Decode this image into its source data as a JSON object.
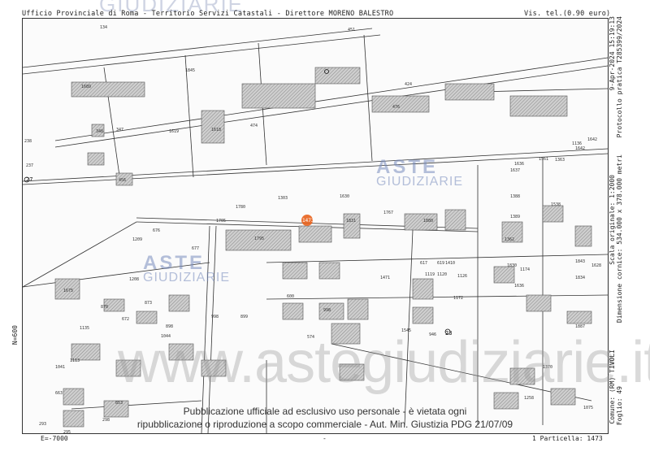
{
  "header": {
    "title": "Ufficio Provinciale di Roma - Territorio Servizi Catastali - Direttore MORENO BALESTRO",
    "fee": "Vis. tel.(0.90 euro)"
  },
  "side_info": {
    "date": "9-Apr-2024 15:19:13",
    "protocol": "Protocollo pratica T285399/2024",
    "scale": "Scala originale: 1:2000",
    "dimensions": "Dimensione cornice: 534.000 x 378.000 metri",
    "comune": "Comune: (RM) TIVOLI",
    "foglio": "Foglio: 49",
    "northing": "N=600"
  },
  "footer": {
    "easting": "E=-7000",
    "particella": "1 Particella: 1473",
    "dash": "-"
  },
  "watermark": {
    "site": "www.astegiudiziarie.it",
    "logo_a": "ASTE",
    "logo_g": "GIUDIZIARIE",
    "top_logo": "GIUDIZIARIE"
  },
  "legal": {
    "line1": "Pubblicazione ufficiale ad esclusivo uso personale - è vietata ogni",
    "line2": "ripubblicazione o riproduzione a scopo commerciale - Aut. Min. Giustizia PDG 21/07/09"
  },
  "parcels": {
    "highlighted": "1473",
    "labels": [
      "134",
      "451",
      "1845",
      "1689",
      "424",
      "474",
      "476",
      "348",
      "347",
      "1619",
      "1618",
      "238",
      "237",
      "456",
      "1705",
      "1795",
      "1303",
      "1767",
      "1831",
      "1780",
      "1630",
      "1880",
      "1388",
      "1389",
      "1362",
      "1642",
      "1843",
      "1834",
      "1887",
      "1136",
      "676",
      "677",
      "1208",
      "1209",
      "1675",
      "870",
      "873",
      "672",
      "898",
      "998",
      "899",
      "1044",
      "1135",
      "1041",
      "1113",
      "663",
      "853",
      "293",
      "295",
      "298",
      "600",
      "574",
      "998",
      "1172",
      "1471",
      "1410",
      "1545",
      "1258",
      "1370",
      "1075",
      "946",
      "1126",
      "1120",
      "1119",
      "617",
      "619",
      "1174",
      "1636",
      "1636",
      "1561",
      "1363",
      "1830",
      "1637",
      "1538",
      "1642",
      "1628"
    ],
    "markers": [
      "27",
      "23",
      "24"
    ],
    "accent": "#e8621c"
  }
}
